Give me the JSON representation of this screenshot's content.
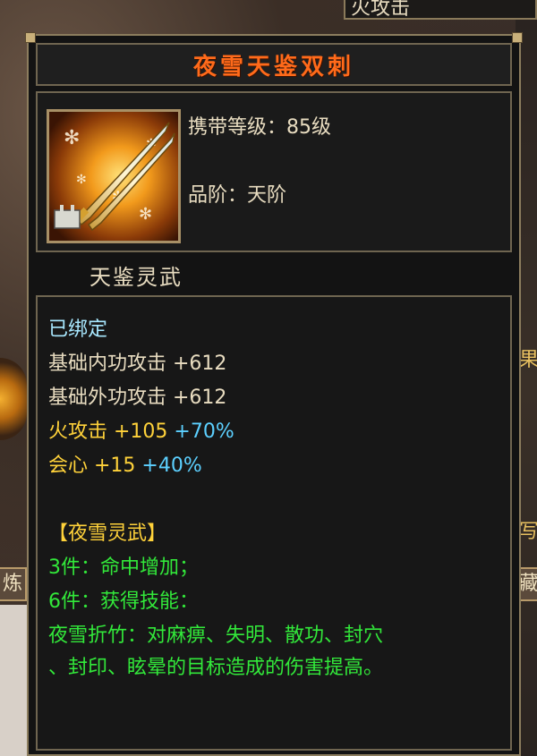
{
  "background": {
    "top_right_label": "火攻击",
    "left_button_label": "炼",
    "right_glyph_top": "果",
    "right_glyph_mid": "写",
    "right_button_label": "藏"
  },
  "tooltip": {
    "title": "夜雪天鉴双刺",
    "carry_level": "携带等级：85级",
    "grade": "品阶：天阶",
    "subtitle": "天鉴灵武",
    "bound": "已绑定",
    "base_inner_attack": "基础内功攻击  +612",
    "base_outer_attack": "基础外功攻击  +612",
    "fire_attack_label": "火攻击  +105",
    "fire_attack_pct": "+70%",
    "crit_label": "会心  +15",
    "crit_pct": "+40%",
    "set_name": "【夜雪灵武】",
    "set_3": "3件：命中增加；",
    "set_6": "6件：获得技能：",
    "skill_line1": "夜雪折竹：对麻痹、失明、散功、封穴",
    "skill_line2": "、封印、眩晕的目标造成的伤害提高。"
  },
  "colors": {
    "title": "#ff6a1a",
    "bound": "#a8e8ff",
    "base_stats": "#e8dcc0",
    "bonus_stats": "#ffd23a",
    "percent": "#5cd0ff",
    "set_text": "#32e83a"
  },
  "icons": {
    "item_icon": "twin-dagger-icon"
  }
}
